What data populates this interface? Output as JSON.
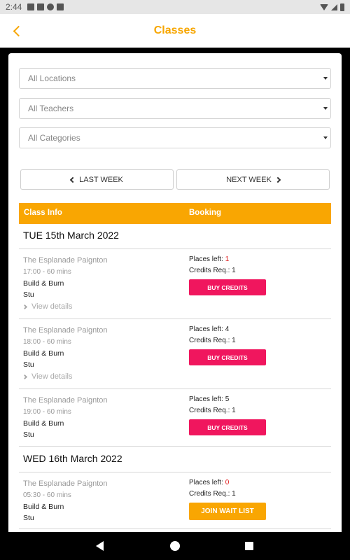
{
  "status_bar": {
    "time": "2:44"
  },
  "header": {
    "title": "Classes"
  },
  "filters": {
    "location": "All Locations",
    "teacher": "All Teachers",
    "category": "All Categories"
  },
  "week_nav": {
    "last": "LAST WEEK",
    "next": "NEXT WEEK"
  },
  "table_header": {
    "class_info": "Class Info",
    "booking": "Booking"
  },
  "days": [
    {
      "heading": "TUE 15th March 2022",
      "classes": [
        {
          "location": "The Esplanade Paignton",
          "time": "17:00 - 60 mins",
          "name": "Build & Burn",
          "teacher": "Stu",
          "details": "View details",
          "places_label": "Places left:",
          "places": "1",
          "credits_label": "Credits Req.:",
          "credits": "1",
          "action": "BUY CREDITS"
        },
        {
          "location": "The Esplanade Paignton",
          "time": "18:00 - 60 mins",
          "name": "Build & Burn",
          "teacher": "Stu",
          "details": "View details",
          "places_label": "Places left:",
          "places": "4",
          "credits_label": "Credits Req.:",
          "credits": "1",
          "action": "BUY CREDITS"
        },
        {
          "location": "The Esplanade Paignton",
          "time": "19:00 - 60 mins",
          "name": "Build & Burn",
          "teacher": "Stu",
          "places_label": "Places left:",
          "places": "5",
          "credits_label": "Credits Req.:",
          "credits": "1",
          "action": "BUY CREDITS"
        }
      ]
    },
    {
      "heading": "WED 16th March 2022",
      "classes": [
        {
          "location": "The Esplanade Paignton",
          "time": "05:30 - 60 mins",
          "name": "Build & Burn",
          "teacher": "Stu",
          "places_label": "Places left:",
          "places": "0",
          "credits_label": "Credits Req.:",
          "credits": "1",
          "action": "JOIN WAIT LIST"
        }
      ]
    }
  ],
  "colors": {
    "accent": "#f9a602",
    "buy_button": "#f0165e",
    "low_places": "#e01919"
  }
}
